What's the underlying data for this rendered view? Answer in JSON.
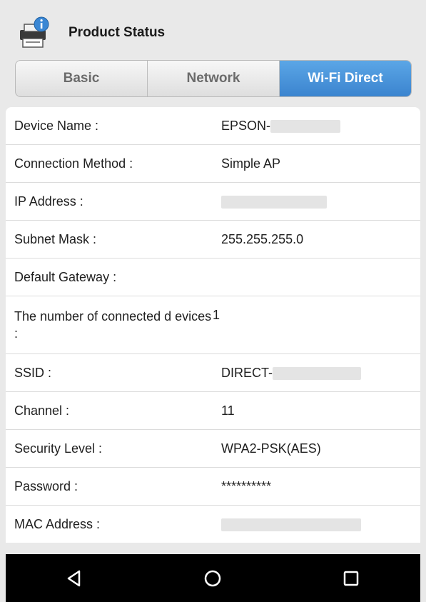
{
  "header": {
    "title": "Product Status",
    "icon": "printer-info-icon"
  },
  "tabs": [
    {
      "label": "Basic",
      "active": false
    },
    {
      "label": "Network",
      "active": false
    },
    {
      "label": "Wi-Fi Direct",
      "active": true
    }
  ],
  "rows": [
    {
      "label": "Device Name :",
      "value": "EPSON-"
    },
    {
      "label": "Connection Method :",
      "value": "Simple AP"
    },
    {
      "label": "IP Address :",
      "value": ""
    },
    {
      "label": "Subnet Mask :",
      "value": "255.255.255.0"
    },
    {
      "label": "Default Gateway :",
      "value": ""
    },
    {
      "label": "The number of connected d evices :",
      "value": "1"
    },
    {
      "label": "SSID :",
      "value": "DIRECT-"
    },
    {
      "label": "Channel :",
      "value": "11"
    },
    {
      "label": "Security Level :",
      "value": "WPA2-PSK(AES)"
    },
    {
      "label": "Password :",
      "value": "**********"
    },
    {
      "label": "MAC Address :",
      "value": ""
    }
  ],
  "navbar": {
    "back_icon": "back-triangle-icon",
    "home_icon": "home-circle-icon",
    "recents_icon": "recents-square-icon"
  },
  "colors": {
    "active_tab": "#3b84cf",
    "navbar_bg": "#000000"
  }
}
